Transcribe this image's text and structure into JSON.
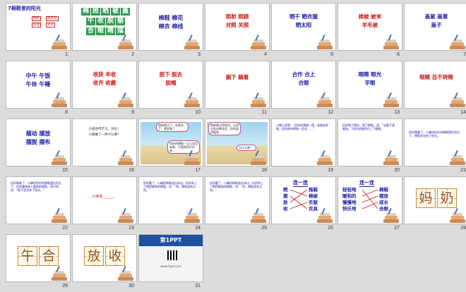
{
  "slides": [
    {
      "num": "1",
      "title": "7棉鞋里的阳光",
      "b1": "棉鞋",
      "b2": "晒太阳",
      "b3": "照射",
      "b4": "外衣"
    },
    {
      "num": "2",
      "row1": [
        "棉",
        "照",
        "晒",
        "被",
        "盖"
      ],
      "row2": [
        "午",
        "收",
        "脱",
        "躺"
      ],
      "row3": [
        "合",
        "眼",
        "睛",
        "摆"
      ]
    },
    {
      "num": "3",
      "l1": "棉鞋  棉花",
      "l2": "棉衣  棉线"
    },
    {
      "num": "4",
      "l1": "照射  照顾",
      "l2": "对照  关照"
    },
    {
      "num": "5",
      "l1": "晒干  晒衣服",
      "l2": "晒太阳"
    },
    {
      "num": "6",
      "l1": "棉被  被单",
      "l2": "羊毛被"
    },
    {
      "num": "7",
      "l1": "盖紧  盖章",
      "l2": "盖子"
    },
    {
      "num": "8",
      "l1": "中午  午饭",
      "l2": "午休  午睡"
    },
    {
      "num": "9",
      "l1": "收获  丰收",
      "l2": "收齐  收藏"
    },
    {
      "num": "10",
      "l1": "脱下  脱去",
      "l2": "脱帽"
    },
    {
      "num": "11",
      "l1": "躺下  躺着"
    },
    {
      "num": "12",
      "l1": "合作  合上",
      "l2": "合眼"
    },
    {
      "num": "13",
      "l1": "眼睛  眼光",
      "l2": "字眼"
    },
    {
      "num": "14",
      "l1": "眼睛  目不转睛"
    },
    {
      "num": "15",
      "l1": "摆动  摆放",
      "l2": "摆脱  摆布"
    },
    {
      "num": "16",
      "l1": "小组合作学习，讨论：",
      "l2": "小峰做了一件什么事？"
    },
    {
      "num": "17",
      "bubble1": "棉被晒过了，软更多了，更舒服了...",
      "bubble2": "奶奶的棉鞋一点儿也没有晒，不暖和也不好穿..."
    },
    {
      "num": "18",
      "bubble1": "棉被晒过得很松，让阳光钻进棉花里，奶奶盖得暖和...",
      "bubble2": "为什么呢？"
    },
    {
      "num": "19",
      "text": "小峰心里想：“奶奶的棉被一晒，盖着很舒服，奶奶穿的棉鞋一定也……”"
    },
    {
      "num": "20",
      "text": "奶奶躺下睡觉，脱下棉鞋，说：“这鞋子真暖和。”奶奶说着就合上了眼睛。"
    },
    {
      "num": "21",
      "text": "奶奶睡着了，小峰把奶奶的棉鞋摆在阳光下，棉鞋里也有了阳光。"
    },
    {
      "num": "22",
      "text": "奶奶睡着了，小峰把奶奶的棉鞋摆在阳光下，奶奶醒来穿上暖和的棉鞋，高兴地说：“鞋子里也有了阳光。”"
    },
    {
      "num": "23",
      "text": "小峰真______。"
    },
    {
      "num": "24",
      "text": "奶奶醒了，小峰把棉鞋放在床边。奶奶穿上了晒得暖和的棉鞋，说：“呀，棉鞋里有太阳。”"
    },
    {
      "num": "25",
      "text": "奶奶醒了，小峰把棉鞋放在床边。奶奶穿上了晒得暖和的棉鞋，说：“呀，棉鞋里有太阳。”"
    },
    {
      "num": "26",
      "title": "连一连",
      "left": [
        "晒",
        "摆",
        "放",
        "收"
      ],
      "right": [
        "拖鞋",
        "棉被",
        "衣服",
        "农具"
      ]
    },
    {
      "num": "27",
      "title": "连一连",
      "left": [
        "轻轻地",
        "暖和的",
        "慢慢地",
        "快乐地"
      ],
      "right": [
        "棉鞋",
        "摆放",
        "成长",
        "合眼"
      ]
    },
    {
      "num": "28",
      "chars": [
        "妈",
        "奶"
      ]
    },
    {
      "num": "29",
      "chars": [
        "午",
        "合"
      ]
    },
    {
      "num": "30",
      "chars": [
        "放",
        "收"
      ]
    },
    {
      "num": "31",
      "brand": "第1PPT",
      "url": "www.1ppt.com"
    }
  ]
}
